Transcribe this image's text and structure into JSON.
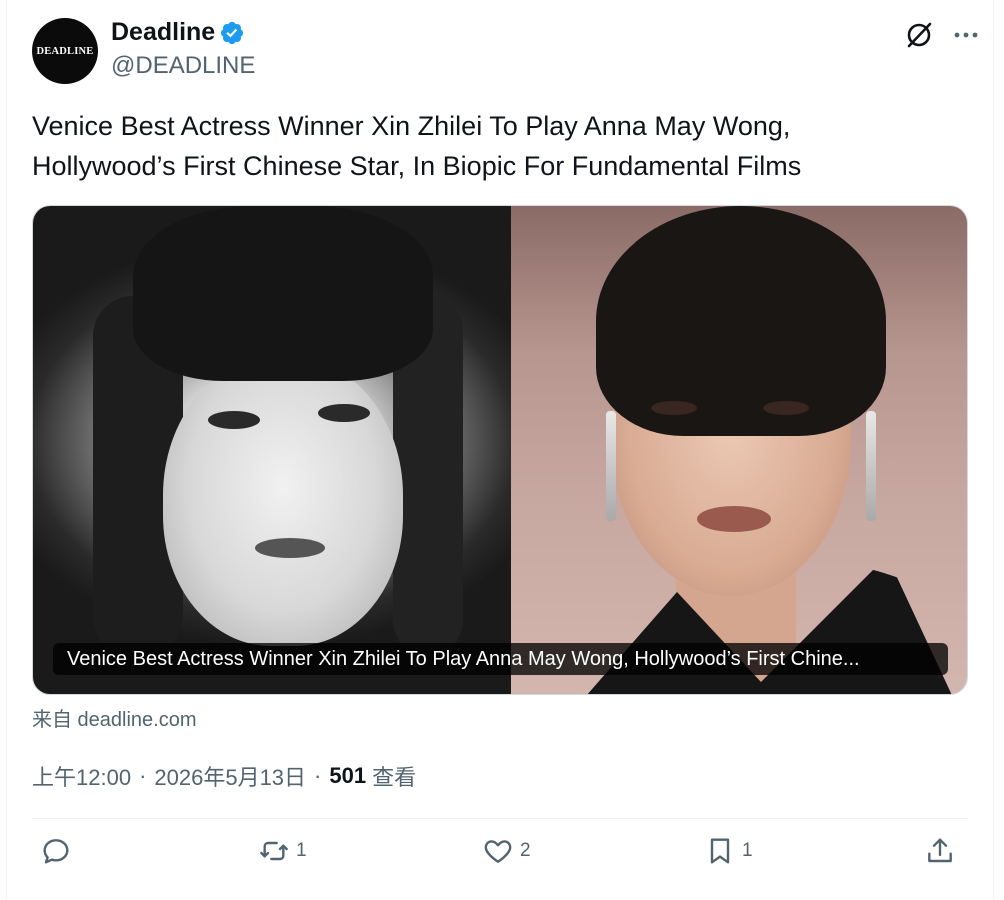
{
  "account": {
    "avatar_text": "DEADLINE",
    "display_name": "Deadline",
    "handle": "@DEADLINE",
    "verified": true
  },
  "tweet": {
    "text": "Venice Best Actress Winner Xin Zhilei To Play Anna May Wong, Hollywood’s First Chinese Star, In Biopic For Fundamental Films"
  },
  "card": {
    "caption": "Venice Best Actress Winner Xin Zhilei To Play Anna May Wong, Hollywood’s First Chine...",
    "source": "来自 deadline.com"
  },
  "meta": {
    "time": "上午12:00",
    "date": "2026年5月13日",
    "views_count": "501",
    "views_label": "查看"
  },
  "actions": {
    "reply_count": "",
    "retweet_count": "1",
    "like_count": "2",
    "bookmark_count": "1"
  },
  "icons": [
    "verified-icon",
    "grok-icon",
    "more-icon",
    "reply-icon",
    "retweet-icon",
    "like-icon",
    "bookmark-icon",
    "share-icon"
  ],
  "colors": {
    "verified": "#1d9bf0",
    "text": "#0f1419",
    "secondary": "#536471",
    "border": "#cfd9de"
  }
}
